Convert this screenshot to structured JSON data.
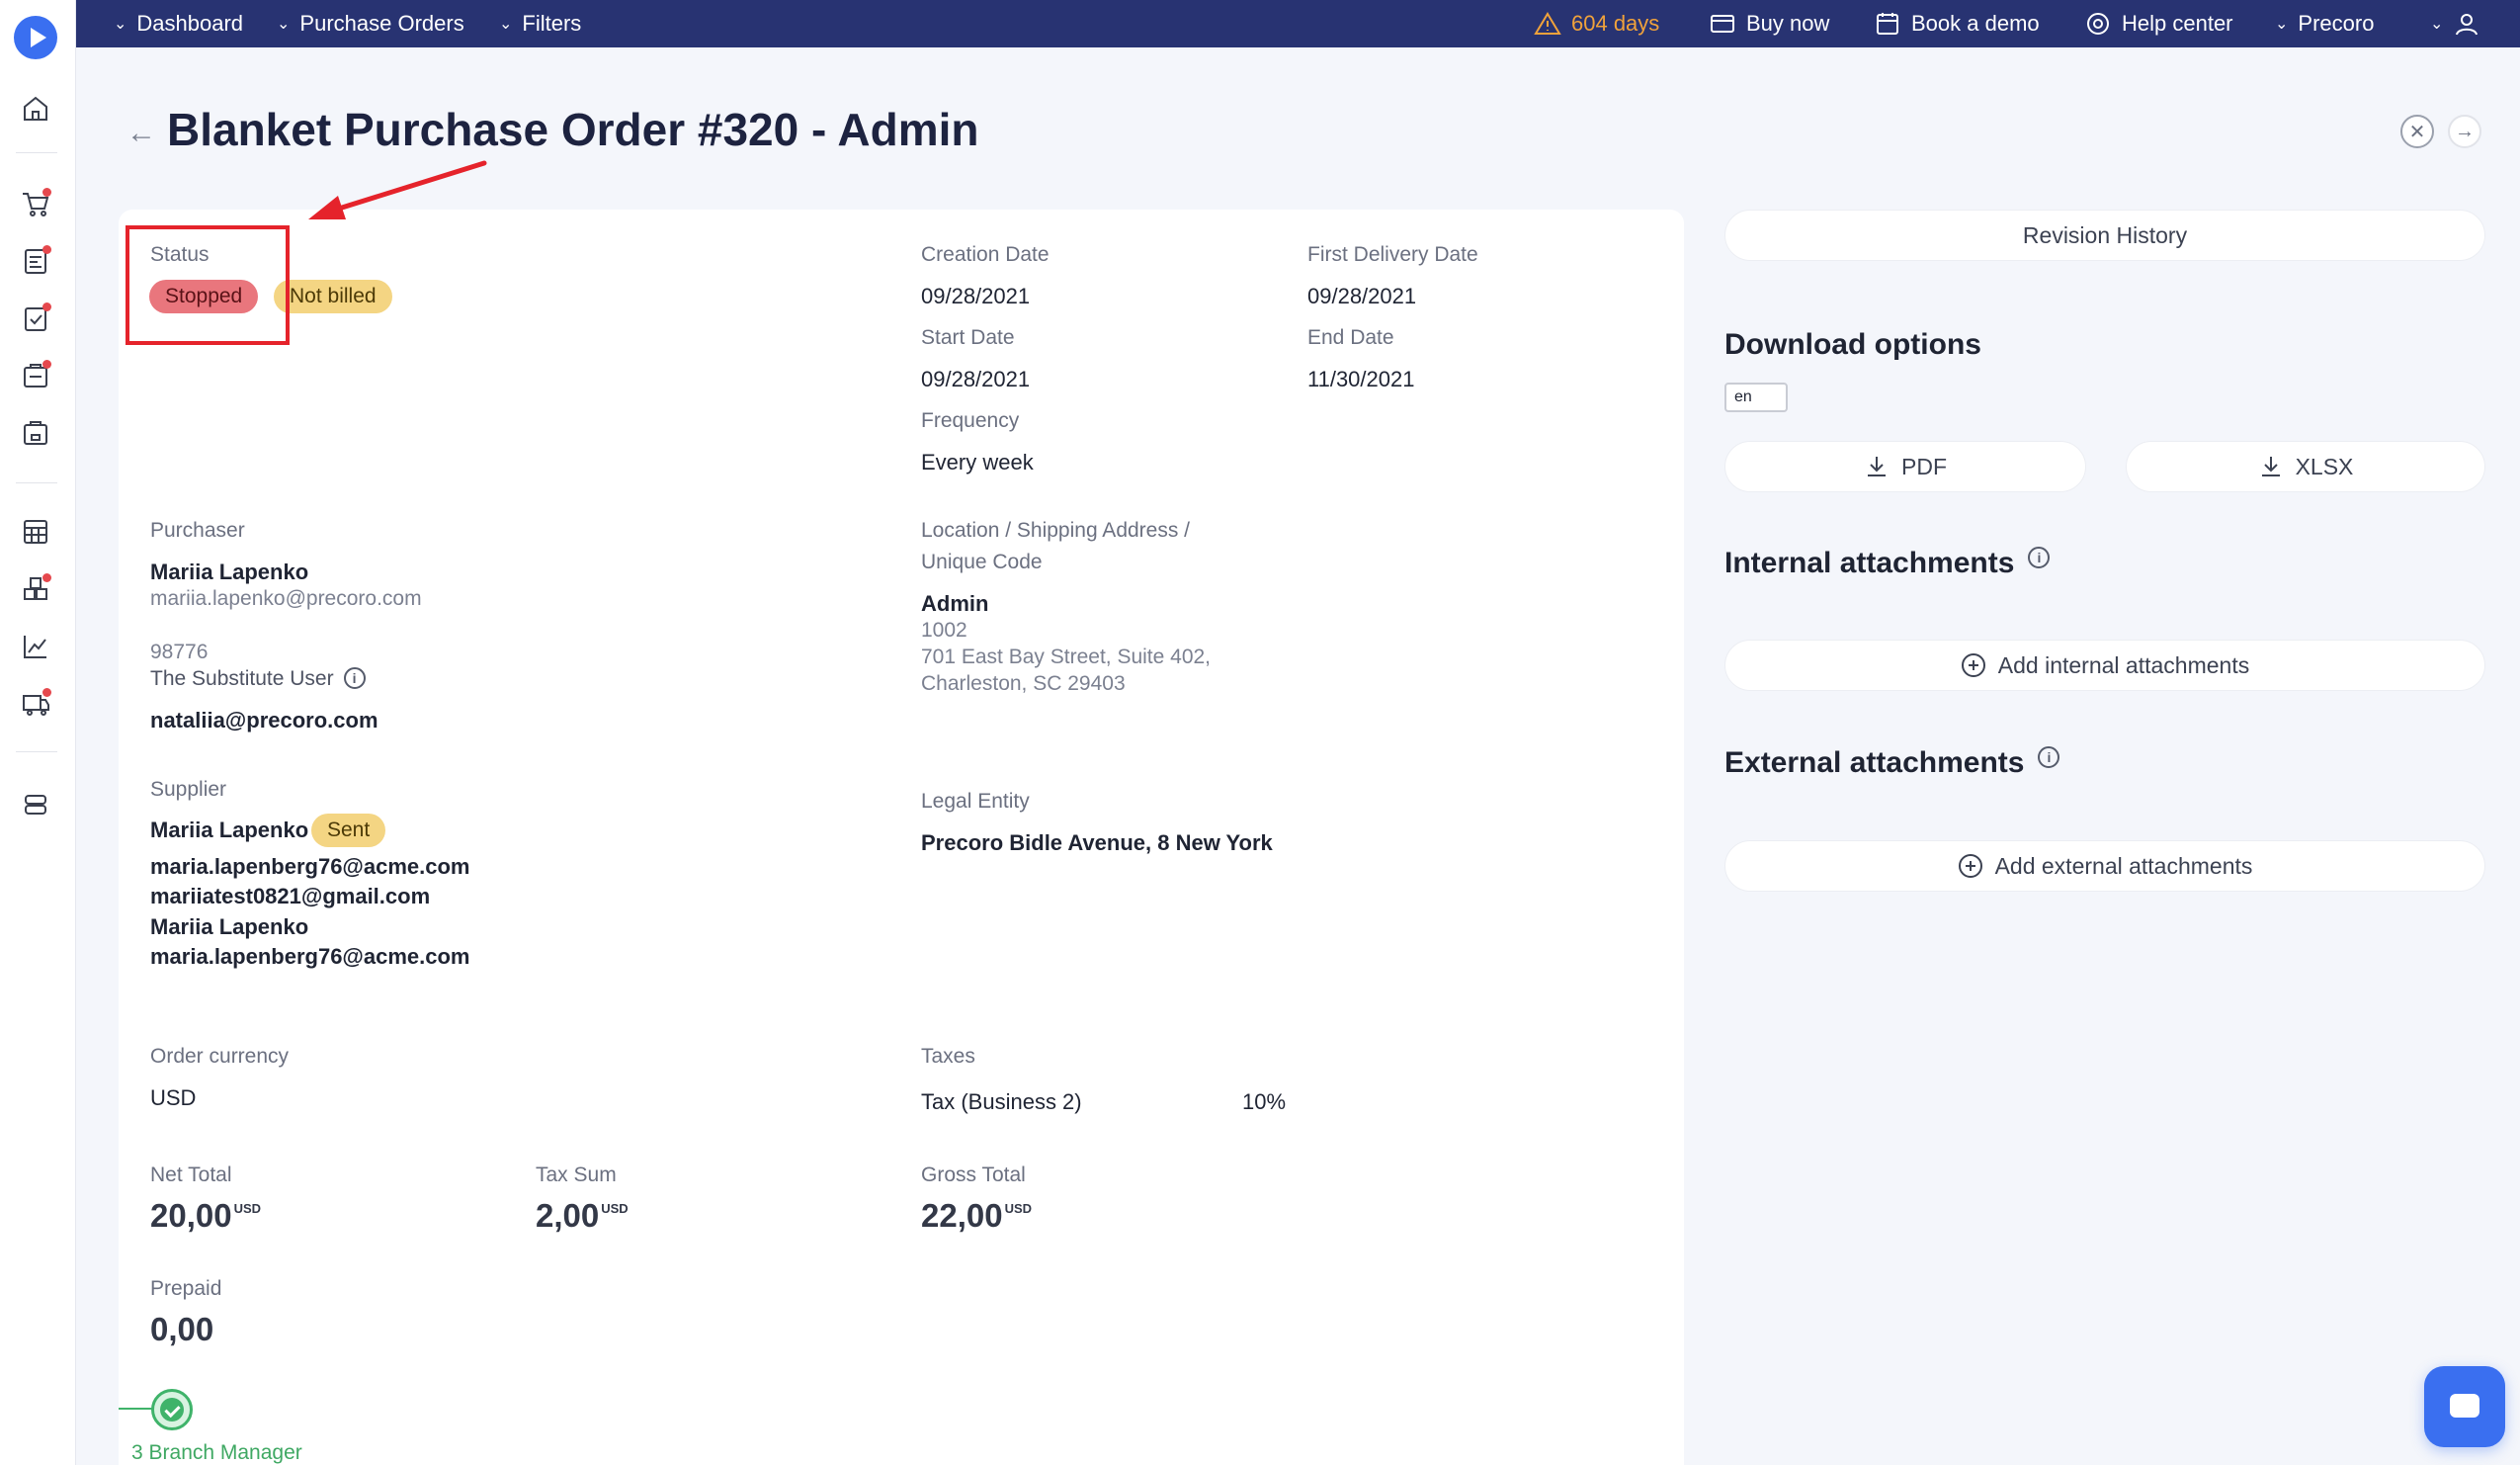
{
  "topbar": {
    "nav": [
      "Dashboard",
      "Purchase Orders",
      "Filters"
    ],
    "trial": "604 days",
    "buy_now": "Buy now",
    "book_demo": "Book a demo",
    "help_center": "Help center",
    "company": "Precoro"
  },
  "header": {
    "back_icon": "←",
    "title": "Blanket Purchase Order #320 - Admin",
    "close_icon": "✕",
    "next_icon": "→"
  },
  "status": {
    "label": "Status",
    "badge_stopped": "Stopped",
    "badge_billing": "Not billed"
  },
  "dates": {
    "creation_label": "Creation Date",
    "creation_value": "09/28/2021",
    "first_delivery_label": "First Delivery Date",
    "first_delivery_value": "09/28/2021",
    "start_label": "Start Date",
    "start_value": "09/28/2021",
    "end_label": "End Date",
    "end_value": "11/30/2021",
    "frequency_label": "Frequency",
    "frequency_value": "Every week"
  },
  "purchaser": {
    "label": "Purchaser",
    "name": "Mariia Lapenko",
    "email": "mariia.lapenko@precoro.com",
    "code": "98776",
    "substitute_label": "The Substitute User",
    "substitute_email": "nataliia@precoro.com"
  },
  "location": {
    "label_line1": "Location / Shipping Address /",
    "label_line2": "Unique Code",
    "name": "Admin",
    "code": "1002",
    "address_line1": "701 East Bay Street, Suite 402,",
    "address_line2": "Charleston, SC 29403"
  },
  "supplier": {
    "label": "Supplier",
    "name": "Mariia Lapenko",
    "badge": "Sent",
    "email1": "maria.lapenberg76@acme.com",
    "email2": "mariiatest0821@gmail.com",
    "contact_name": "Mariia Lapenko",
    "contact_email": "maria.lapenberg76@acme.com"
  },
  "legal": {
    "label": "Legal Entity",
    "value": "Precoro Bidle Avenue, 8 New York"
  },
  "currency": {
    "label": "Order currency",
    "value": "USD"
  },
  "taxes": {
    "label": "Taxes",
    "name": "Tax (Business 2)",
    "rate": "10%"
  },
  "totals": {
    "net_label": "Net Total",
    "net_value": "20,00",
    "tax_label": "Tax Sum",
    "tax_value": "2,00",
    "gross_label": "Gross Total",
    "gross_value": "22,00",
    "unit": "USD",
    "prepaid_label": "Prepaid",
    "prepaid_value": "0,00"
  },
  "approval": {
    "step_label": "3 Branch Manager"
  },
  "right_panel": {
    "revision_history": "Revision History",
    "download_title": "Download options",
    "language": "en",
    "pdf": "PDF",
    "xlsx": "XLSX",
    "internal_title": "Internal attachments",
    "add_internal": "Add internal attachments",
    "external_title": "External attachments",
    "add_external": "Add external attachments"
  },
  "colors": {
    "topbar": "#283372",
    "accent_blue": "#3a6ff0",
    "stopped_badge": "#e9767d",
    "yellow_badge": "#f4d583",
    "trial_warning": "#f0a23b",
    "approved_green": "#3fb36a",
    "annotation_red": "#e5232b"
  }
}
